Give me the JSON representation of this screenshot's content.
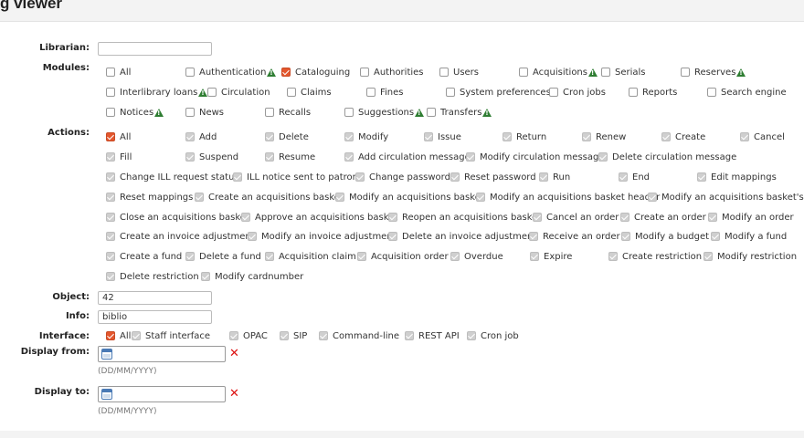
{
  "page": {
    "title": "g viewer"
  },
  "form": {
    "librarian_label": "Librarian:",
    "librarian_value": "",
    "modules_label": "Modules:",
    "modules": [
      {
        "label": "All",
        "checked": false,
        "warn": false
      },
      {
        "label": "Authentication",
        "checked": false,
        "warn": true
      },
      {
        "label": "Cataloguing",
        "checked": true,
        "warn": false
      },
      {
        "label": "Authorities",
        "checked": false,
        "warn": false
      },
      {
        "label": "Users",
        "checked": false,
        "warn": false
      },
      {
        "label": "Acquisitions",
        "checked": false,
        "warn": true
      },
      {
        "label": "Serials",
        "checked": false,
        "warn": false
      },
      {
        "label": "Reserves",
        "checked": false,
        "warn": true
      },
      {
        "label": "Interlibrary loans",
        "checked": false,
        "warn": true
      },
      {
        "label": "Circulation",
        "checked": false,
        "warn": false
      },
      {
        "label": "Claims",
        "checked": false,
        "warn": false
      },
      {
        "label": "Fines",
        "checked": false,
        "warn": false
      },
      {
        "label": "System preferences",
        "checked": false,
        "warn": false
      },
      {
        "label": "Cron jobs",
        "checked": false,
        "warn": false
      },
      {
        "label": "Reports",
        "checked": false,
        "warn": false
      },
      {
        "label": "Search engine",
        "checked": false,
        "warn": false
      },
      {
        "label": "Notices",
        "checked": false,
        "warn": true
      },
      {
        "label": "News",
        "checked": false,
        "warn": false
      },
      {
        "label": "Recalls",
        "checked": false,
        "warn": false
      },
      {
        "label": "Suggestions",
        "checked": false,
        "warn": true
      },
      {
        "label": "Transfers",
        "checked": false,
        "warn": true
      }
    ],
    "actions_label": "Actions:",
    "actions": [
      {
        "label": "All",
        "state": "checked"
      },
      {
        "label": "Add",
        "state": "dim"
      },
      {
        "label": "Delete",
        "state": "dim"
      },
      {
        "label": "Modify",
        "state": "dim"
      },
      {
        "label": "Issue",
        "state": "dim"
      },
      {
        "label": "Return",
        "state": "dim"
      },
      {
        "label": "Renew",
        "state": "dim"
      },
      {
        "label": "Create",
        "state": "dim"
      },
      {
        "label": "Cancel",
        "state": "dim"
      },
      {
        "label": "Fill",
        "state": "dim"
      },
      {
        "label": "Suspend",
        "state": "dim"
      },
      {
        "label": "Resume",
        "state": "dim"
      },
      {
        "label": "Add circulation message",
        "state": "dim"
      },
      {
        "label": "Modify circulation message",
        "state": "dim"
      },
      {
        "label": "Delete circulation message",
        "state": "dim"
      },
      {
        "label": "Change ILL request status",
        "state": "dim"
      },
      {
        "label": "ILL notice sent to patron",
        "state": "dim"
      },
      {
        "label": "Change password",
        "state": "dim"
      },
      {
        "label": "Reset password",
        "state": "dim"
      },
      {
        "label": "Run",
        "state": "dim"
      },
      {
        "label": "End",
        "state": "dim"
      },
      {
        "label": "Edit mappings",
        "state": "dim"
      },
      {
        "label": "Reset mappings",
        "state": "dim"
      },
      {
        "label": "Create an acquisitions basket",
        "state": "dim"
      },
      {
        "label": "Modify an acquisitions basket",
        "state": "dim"
      },
      {
        "label": "Modify an acquisitions basket header",
        "state": "dim"
      },
      {
        "label": "Modify an acquisitions basket's users",
        "state": "dim"
      },
      {
        "label": "Close an acquisitions basket",
        "state": "dim"
      },
      {
        "label": "Approve an acquisitions basket",
        "state": "dim"
      },
      {
        "label": "Reopen an acquisitions basket",
        "state": "dim"
      },
      {
        "label": "Cancel an order",
        "state": "dim"
      },
      {
        "label": "Create an order",
        "state": "dim"
      },
      {
        "label": "Modify an order",
        "state": "dim"
      },
      {
        "label": "Create an invoice adjustment",
        "state": "dim"
      },
      {
        "label": "Modify an invoice adjustment",
        "state": "dim"
      },
      {
        "label": "Delete an invoice adjustment",
        "state": "dim"
      },
      {
        "label": "Receive an order",
        "state": "dim"
      },
      {
        "label": "Modify a budget",
        "state": "dim"
      },
      {
        "label": "Modify a fund",
        "state": "dim"
      },
      {
        "label": "Create a fund",
        "state": "dim"
      },
      {
        "label": "Delete a fund",
        "state": "dim"
      },
      {
        "label": "Acquisition claim",
        "state": "dim"
      },
      {
        "label": "Acquisition order",
        "state": "dim"
      },
      {
        "label": "Overdue",
        "state": "dim"
      },
      {
        "label": "Expire",
        "state": "dim"
      },
      {
        "label": "Create restriction",
        "state": "dim"
      },
      {
        "label": "Modify restriction",
        "state": "dim"
      },
      {
        "label": "Delete restriction",
        "state": "dim"
      },
      {
        "label": "Modify cardnumber",
        "state": "dim"
      }
    ],
    "object_label": "Object:",
    "object_value": "42",
    "info_label": "Info:",
    "info_value": "biblio",
    "interface_label": "Interface:",
    "interfaces": [
      {
        "label": "All",
        "state": "checked"
      },
      {
        "label": "Staff interface",
        "state": "dim"
      },
      {
        "label": "OPAC",
        "state": "dim"
      },
      {
        "label": "SIP",
        "state": "dim"
      },
      {
        "label": "Command-line",
        "state": "dim"
      },
      {
        "label": "REST API",
        "state": "dim"
      },
      {
        "label": "Cron job",
        "state": "dim"
      }
    ],
    "display_from_label": "Display from:",
    "display_from_value": "",
    "display_to_label": "Display to:",
    "display_to_value": "",
    "date_hint": "(DD/MM/YYYY)",
    "clear_glyph": "✕"
  },
  "colors": {
    "checked": "#e4572e",
    "warning": "#2e7d32",
    "clear": "#dd1111"
  }
}
